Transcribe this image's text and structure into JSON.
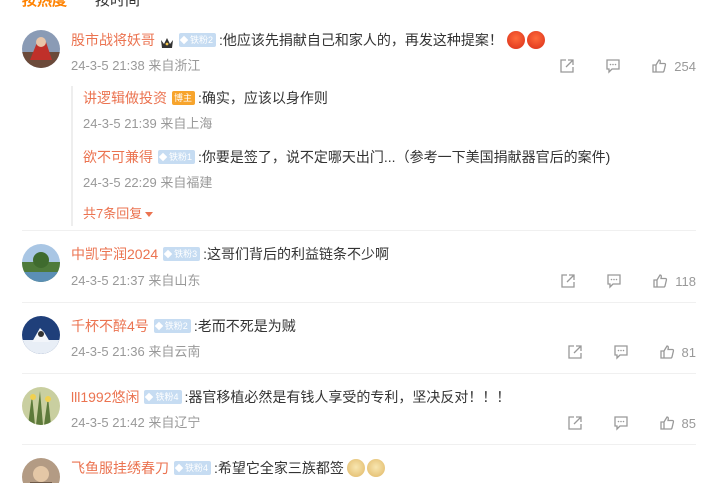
{
  "tabs": [
    {
      "label": "按热度",
      "active": true
    },
    {
      "label": "按时间",
      "active": false
    }
  ],
  "comments": [
    {
      "user": "股市战将妖哥",
      "badge": "铁粉2",
      "text": ":他应该先捐献自己和家人的，再发这种提案！",
      "meta": "24-3-5 21:38 来自浙江",
      "likes": "254",
      "emoji_icons": [
        "angry-face-icon",
        "angry-face-icon"
      ],
      "replies": [
        {
          "user": "讲逻辑做投资",
          "badge": "博主",
          "text": ":确实，应该以身作则",
          "meta": "24-3-5 21:39 来自上海"
        },
        {
          "user": "欲不可兼得",
          "badge": "铁粉1",
          "text": ":你要是签了，说不定哪天出门...（参考一下美国捐献器官后的案件)",
          "meta": "24-3-5 22:29 来自福建"
        }
      ],
      "more_replies": "共7条回复"
    },
    {
      "user": "中凯宇润2024",
      "badge": "铁粉3",
      "text": ":这哥们背后的利益链条不少啊",
      "meta": "24-3-5 21:37 来自山东",
      "likes": "118"
    },
    {
      "user": "千杯不醉4号",
      "badge": "铁粉2",
      "text": ":老而不死是为贼",
      "meta": "24-3-5 21:36 来自云南",
      "likes": "81"
    },
    {
      "user": "lll1992悠闲",
      "badge": "铁粉4",
      "text": ":器官移植必然是有钱人享受的专利，坚决反对！！！",
      "meta": "24-3-5 21:42 来自辽宁",
      "likes": "85"
    },
    {
      "user": "飞鱼服挂绣春刀",
      "badge": "铁粉4",
      "text": ":希望它全家三族都签",
      "emoji_icons": [
        "doge-icon",
        "doge-icon"
      ]
    }
  ],
  "colors": {
    "accent": "#ff8200",
    "username": "#eb7350",
    "meta": "#999999",
    "badge": "#c6dcf2",
    "boss_badge": "#f7a42c"
  }
}
